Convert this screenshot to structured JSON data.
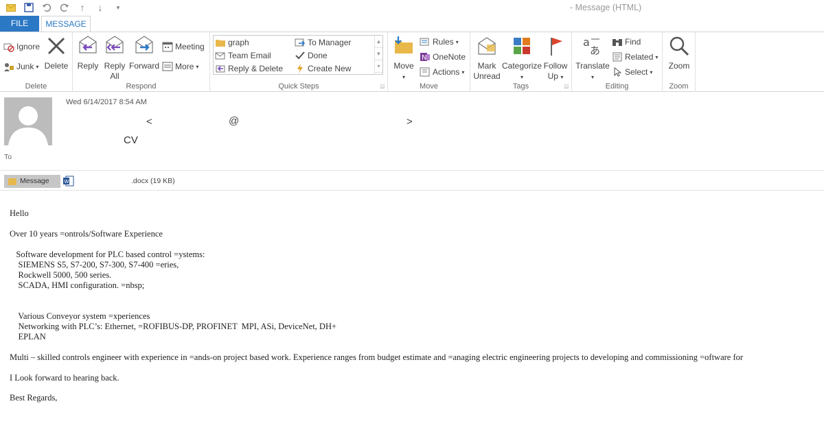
{
  "window": {
    "title": "- Message (HTML)"
  },
  "qat": {
    "icons": [
      "mail-icon",
      "save-icon",
      "undo-icon",
      "redo-icon",
      "up-arrow-icon",
      "down-arrow-icon",
      "customize-icon"
    ]
  },
  "tabs": {
    "file": "FILE",
    "message": "MESSAGE"
  },
  "ribbon": {
    "delete_group": {
      "label": "Delete",
      "ignore": "Ignore",
      "junk": "Junk",
      "delete": "Delete"
    },
    "respond_group": {
      "label": "Respond",
      "reply": "Reply",
      "reply_all_1": "Reply",
      "reply_all_2": "All",
      "forward": "Forward",
      "meeting": "Meeting",
      "more": "More"
    },
    "quicksteps_group": {
      "label": "Quick Steps",
      "items": [
        "graph",
        "To Manager",
        "Team Email",
        "Done",
        "Reply & Delete",
        "Create New"
      ]
    },
    "move_group": {
      "label": "Move",
      "move": "Move",
      "rules": "Rules",
      "onenote": "OneNote",
      "actions": "Actions"
    },
    "tags_group": {
      "label": "Tags",
      "mark_unread_1": "Mark",
      "mark_unread_2": "Unread",
      "categorize": "Categorize",
      "follow_up_1": "Follow",
      "follow_up_2": "Up"
    },
    "editing_group": {
      "label": "Editing",
      "translate": "Translate",
      "find": "Find",
      "related": "Related",
      "select": "Select"
    },
    "zoom_group": {
      "label": "Zoom",
      "zoom": "Zoom"
    }
  },
  "header": {
    "date": "Wed 6/14/2017 8:54 AM",
    "from_lt": "<",
    "from_at": "@",
    "from_gt": ">",
    "subject": "CV",
    "to_label": "To"
  },
  "attachments": {
    "message_tab": "Message",
    "file": ".docx (19 KB)"
  },
  "body": {
    "lines": [
      "Hello",
      "Over 10 years =ontrols/Software Experience",
      "   Software development for PLC based control =ystems:",
      "    SIEMENS S5, S7-200, S7-300, S7-400 =eries,",
      "    Rockwell 5000, 500 series.",
      "    SCADA, HMI configuration. =nbsp;",
      "    Various Conveyor system =xperiences",
      "    Networking with PLC’s: Ethernet, =ROFIBUS-DP, PROFINET  MPI, ASi, DeviceNet, DH+",
      "    EPLAN",
      "Multi – skilled controls engineer with experience in =ands-on project based work. Experience ranges from budget estimate and =anaging electric engineering projects to developing and commissioning =oftware for",
      "I Look forward to hearing back.",
      "Best Regards,"
    ]
  }
}
